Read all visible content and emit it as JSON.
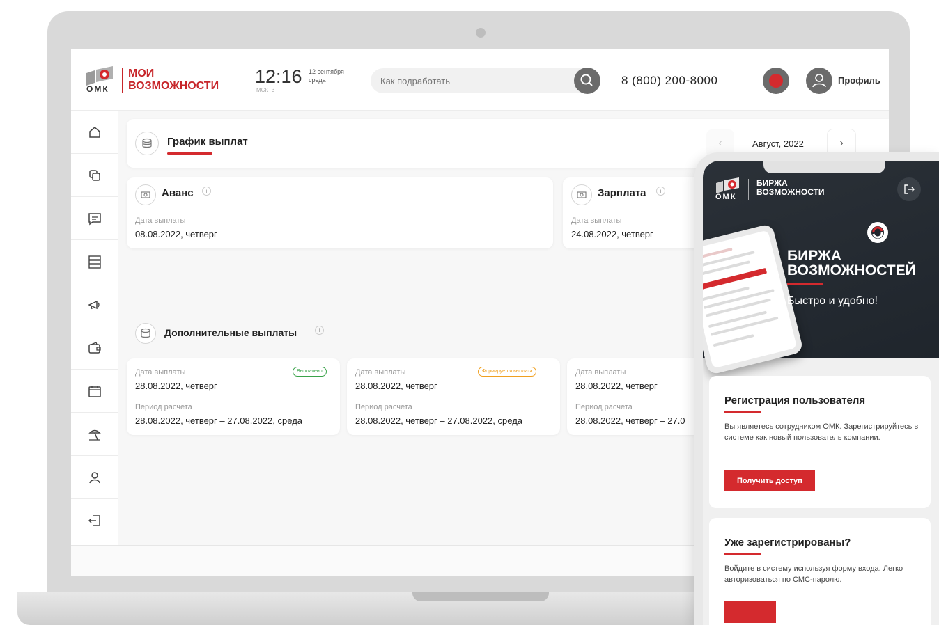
{
  "header": {
    "brand_line1": "МОИ",
    "brand_line2": "ВОЗМОЖНОСТИ",
    "omk_label": "ОМК",
    "time": "12:16",
    "timezone": "МСК+3",
    "date_line1": "12 сентября",
    "date_line2": "среда",
    "search_placeholder": "Как подработать",
    "phone": "8 (800) 200-8000",
    "profile_label": "Профиль"
  },
  "sidebar": {
    "items": [
      {
        "icon": "home-icon"
      },
      {
        "icon": "copy-icon"
      },
      {
        "icon": "chat-icon"
      },
      {
        "icon": "list-icon"
      },
      {
        "icon": "megaphone-icon"
      },
      {
        "icon": "wallet-icon"
      },
      {
        "icon": "calendar-icon"
      },
      {
        "icon": "vacation-icon"
      },
      {
        "icon": "user-icon"
      },
      {
        "icon": "logout-icon"
      }
    ]
  },
  "schedule": {
    "title": "График выплат",
    "month": "Август, 2022",
    "prev": "‹",
    "next": "›"
  },
  "advance": {
    "title": "Аванс",
    "date_label": "Дата выплаты",
    "date_value": "08.08.2022, четверг"
  },
  "salary": {
    "title": "Зарплата",
    "date_label": "Дата выплаты",
    "date_value": "24.08.2022, четверг"
  },
  "extra": {
    "title": "Дополнительные выплаты",
    "cards": [
      {
        "date_label": "Дата выплаты",
        "date_value": "28.08.2022, четверг",
        "period_label": "Период расчета",
        "period_value": "28.08.2022, четверг – 27.08.2022, среда",
        "badge": "Выплачено",
        "badge_color": "#3aa34a"
      },
      {
        "date_label": "Дата выплаты",
        "date_value": "28.08.2022, четверг",
        "period_label": "Период расчета",
        "period_value": "28.08.2022, четверг – 27.08.2022, среда",
        "badge": "Формируется выплата",
        "badge_color": "#f0a020"
      },
      {
        "date_label": "Дата выплаты",
        "date_value": "28.08.2022, четверг",
        "period_label": "Период расчета",
        "period_value": "28.08.2022, четверг – 27.0"
      }
    ]
  },
  "phone": {
    "brand_line1": "БИРЖА",
    "brand_line2": "ВОЗМОЖНОСТИ",
    "omk_label": "ОМК",
    "hero_title_line1": "БИРЖА",
    "hero_title_line2": "ВОЗМОЖНОСТЕЙ",
    "hero_subtitle": "Быстро и удобно!",
    "register": {
      "title": "Регистрация пользователя",
      "text": "Вы являетесь сотрудником ОМК. Зарегистрируйтесь в системе как новый пользователь компании.",
      "button": "Получить доступ"
    },
    "login": {
      "title": "Уже зарегистрированы?",
      "text": "Войдите в систему используя форму входа. Легко авторизоваться по СМС-паролю."
    }
  },
  "colors": {
    "accent": "#d42a2e",
    "dark": "#23292f"
  }
}
